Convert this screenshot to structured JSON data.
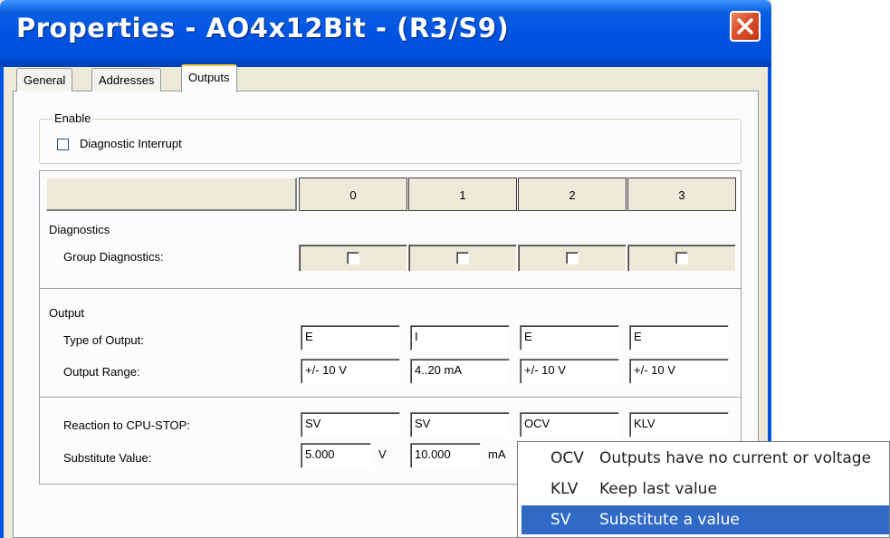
{
  "window": {
    "title": "Properties - AO4x12Bit - (R3/S9)",
    "close_icon": "close-x-icon"
  },
  "tabs": [
    {
      "label": "General",
      "active": false
    },
    {
      "label": "Addresses",
      "active": false
    },
    {
      "label": "Outputs",
      "active": true
    }
  ],
  "enable_group": {
    "label": "Enable",
    "diagnostic_interrupt": {
      "label": "Diagnostic Interrupt",
      "checked": false
    }
  },
  "channels": [
    "0",
    "1",
    "2",
    "3"
  ],
  "diagnostics": {
    "section_label": "Diagnostics",
    "group_diagnostics_label": "Group Diagnostics:",
    "group_diagnostics_values": [
      false,
      false,
      false,
      false
    ]
  },
  "output": {
    "section_label": "Output",
    "type_label": "Type of Output:",
    "types": [
      "E",
      "I",
      "E",
      "E"
    ],
    "range_label": "Output Range:",
    "ranges": [
      "+/- 10 V",
      "4..20 mA",
      "+/- 10 V",
      "+/- 10 V"
    ]
  },
  "reaction": {
    "label": "Reaction to CPU-STOP:",
    "values": [
      "SV",
      "SV",
      "OCV",
      "KLV"
    ]
  },
  "substitute": {
    "label": "Substitute Value:",
    "values": [
      "5.000",
      "10.000"
    ],
    "units": [
      "V",
      "mA"
    ]
  },
  "dropdown": {
    "options": [
      {
        "code": "OCV",
        "description": "Outputs have no current or voltage",
        "selected": false
      },
      {
        "code": "KLV",
        "description": "Keep last value",
        "selected": false
      },
      {
        "code": "SV",
        "description": "Substitute a value",
        "selected": true
      }
    ]
  },
  "colors": {
    "titlebar": "#0054e3",
    "selection": "#316ac5",
    "dialog_face": "#ece9d8",
    "tab_highlight": "#ffc83c"
  }
}
